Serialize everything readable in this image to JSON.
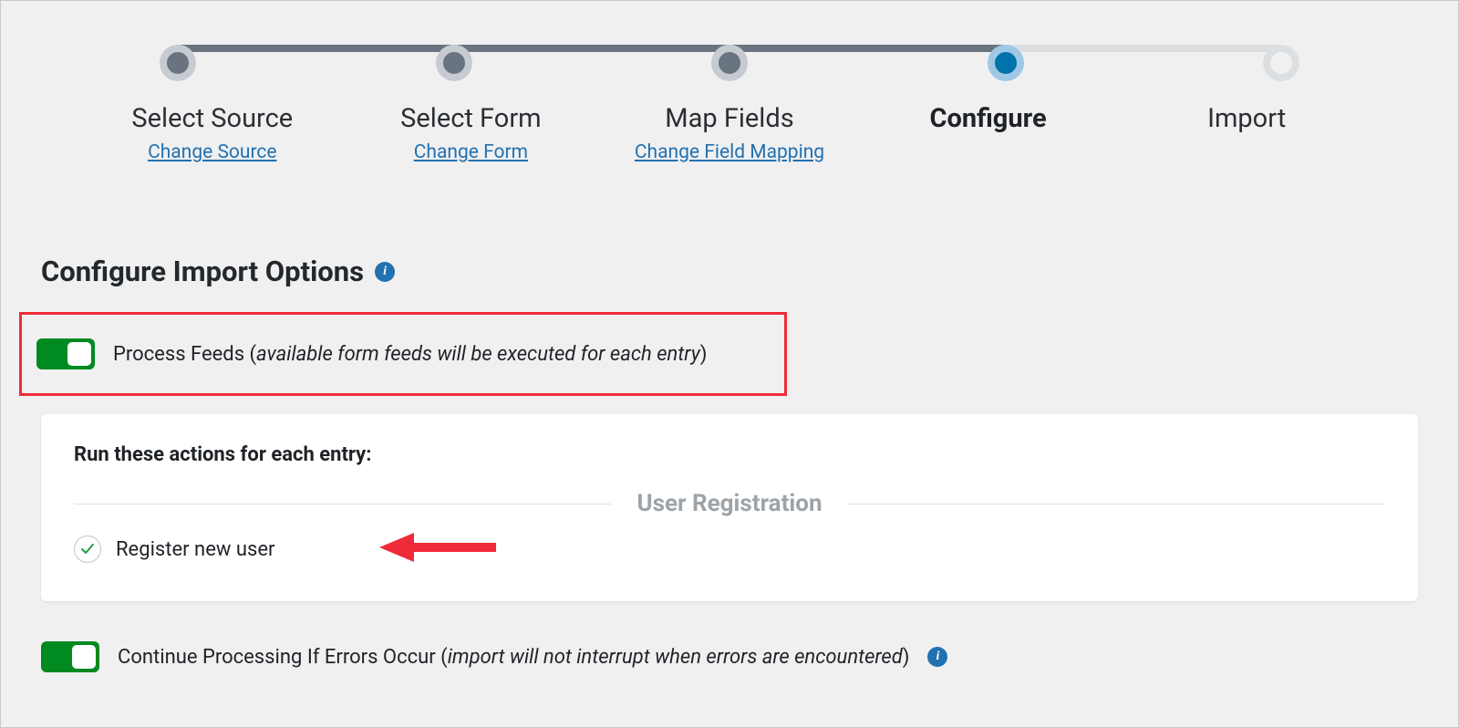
{
  "stepper": {
    "steps": [
      {
        "title": "Select Source",
        "link": "Change Source",
        "state": "done"
      },
      {
        "title": "Select Form",
        "link": "Change Form",
        "state": "done"
      },
      {
        "title": "Map Fields",
        "link": "Change Field Mapping",
        "state": "done"
      },
      {
        "title": "Configure",
        "link": "",
        "state": "active"
      },
      {
        "title": "Import",
        "link": "",
        "state": "future"
      }
    ]
  },
  "heading": "Configure Import Options",
  "option_process_feeds": {
    "label": "Process Feeds",
    "hint_open": "(",
    "hint": "available form feeds will be executed for each entry",
    "hint_close": ")",
    "enabled": true
  },
  "feeds_card": {
    "title": "Run these actions for each entry:",
    "group": "User Registration",
    "items": [
      {
        "label": "Register new user",
        "checked": true
      }
    ]
  },
  "option_continue": {
    "label": "Continue Processing If Errors Occur",
    "hint_open": "(",
    "hint": "import will not interrupt when errors are encountered",
    "hint_close": ")",
    "enabled": true
  },
  "colors": {
    "accent": "#2271b1",
    "green": "#008a20",
    "danger": "#ef2b3a",
    "step_done": "#6a7380",
    "step_ring": "#c6cbd1",
    "step_active": "#0073aa",
    "step_active_ring": "#9fc8e4"
  }
}
